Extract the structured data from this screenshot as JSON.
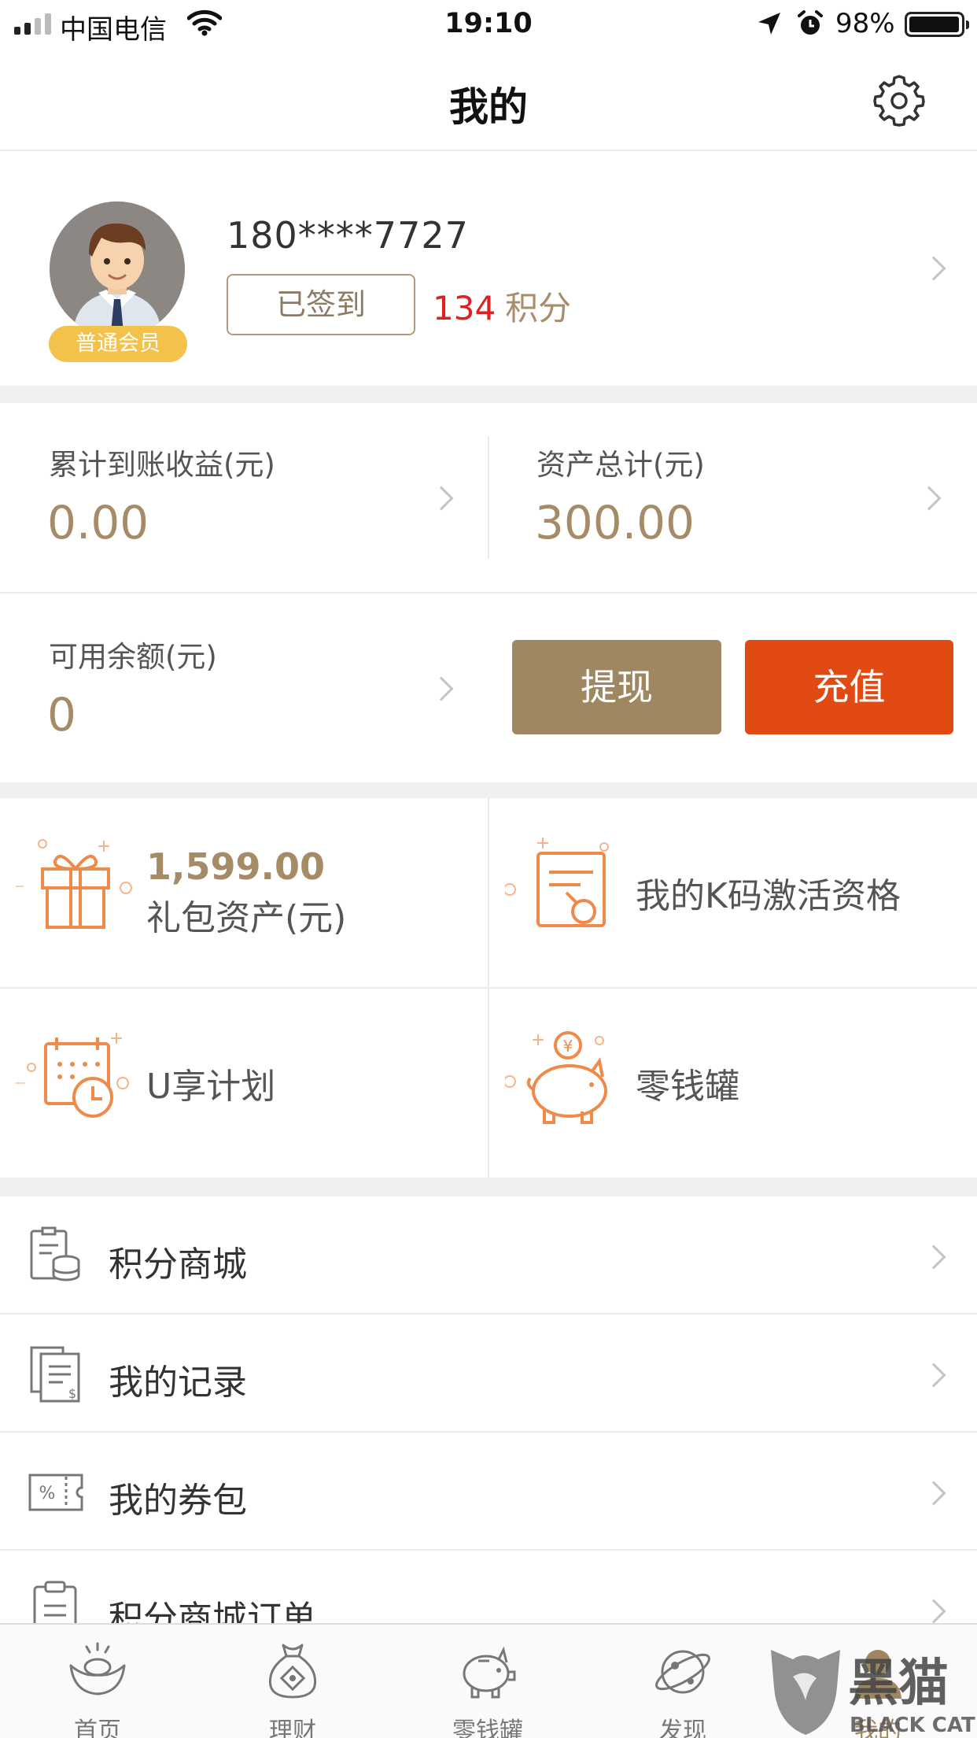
{
  "status_bar": {
    "carrier": "中国电信",
    "time": "19:10",
    "battery": "98%",
    "battery_level": 0.98
  },
  "nav": {
    "title": "我的",
    "settings_icon": "gear-icon"
  },
  "profile": {
    "phone": "180****7727",
    "member_level": "普通会员",
    "signin_label": "已签到",
    "points_value": "134",
    "points_unit": "积分"
  },
  "stats": {
    "earnings_label": "累计到账收益(元)",
    "earnings_value": "0.00",
    "assets_label": "资产总计(元)",
    "assets_value": "300.00",
    "balance_label": "可用余额(元)",
    "balance_value": "0",
    "withdraw_label": "提现",
    "recharge_label": "充值"
  },
  "colors": {
    "gold": "#a58b66",
    "recharge": "#e24a14",
    "withdraw": "#9f8762",
    "badge": "#f3c14c",
    "points": "#e0201e"
  },
  "grid": {
    "gift_value": "1,599.00",
    "gift_label": "礼包资产(元)",
    "kcode_label": "我的K码激活资格",
    "uplan_label": "U享计划",
    "piggy_label": "零钱罐"
  },
  "menu": [
    {
      "label": "积分商城",
      "icon": "coins-icon"
    },
    {
      "label": "我的记录",
      "icon": "records-icon"
    },
    {
      "label": "我的券包",
      "icon": "coupon-icon"
    },
    {
      "label": "积分商城订单",
      "icon": "clipboard-icon"
    }
  ],
  "tabs": [
    {
      "label": "首页",
      "icon": "gold-ingot-icon"
    },
    {
      "label": "理财",
      "icon": "money-bag-icon"
    },
    {
      "label": "零钱罐",
      "icon": "piggy-bank-icon"
    },
    {
      "label": "发现",
      "icon": "planet-icon"
    },
    {
      "label": "我的",
      "icon": "profile-icon"
    }
  ],
  "watermark": {
    "brand": "黑猫",
    "brand_en": "BLACK CAT"
  }
}
